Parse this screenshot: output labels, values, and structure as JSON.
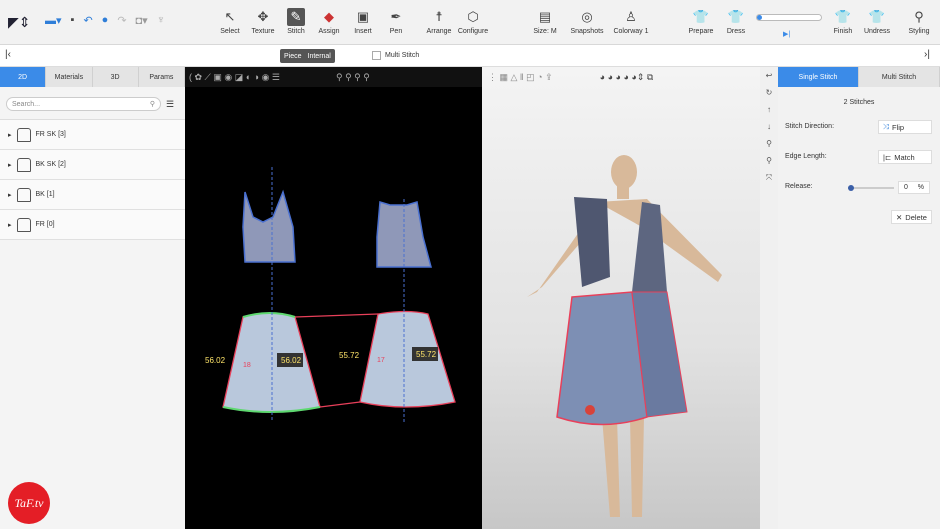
{
  "toolbar": {
    "tools": [
      {
        "label": "Select",
        "icon": "↖"
      },
      {
        "label": "Texture",
        "icon": "✥"
      },
      {
        "label": "Stitch",
        "icon": "✎"
      },
      {
        "label": "Assign",
        "icon": "◆"
      },
      {
        "label": "Insert",
        "icon": "▣"
      },
      {
        "label": "Pen",
        "icon": "✒"
      },
      {
        "label": "Arrange",
        "icon": "☨"
      },
      {
        "label": "Configure",
        "icon": "⬡"
      },
      {
        "label": "Size: M",
        "icon": "▤"
      },
      {
        "label": "Snapshots",
        "icon": "◎"
      },
      {
        "label": "Colorway 1",
        "icon": "♙"
      },
      {
        "label": "Prepare",
        "icon": "👕"
      },
      {
        "label": "Dress",
        "icon": "👕"
      },
      {
        "label": "Finish",
        "icon": "👕"
      },
      {
        "label": "Undress",
        "icon": "👕"
      },
      {
        "label": "Styling",
        "icon": "⚲"
      }
    ],
    "play": "▶|"
  },
  "bar2": {
    "piece": "Piece",
    "internal": "Internal",
    "multi": "Multi Stitch"
  },
  "left": {
    "tabs": [
      "2D",
      "Materials",
      "3D",
      "Params"
    ],
    "search_placeholder": "Search...",
    "items": [
      "FR SK [3]",
      "BK SK [2]",
      "BK [1]",
      "FR [0]"
    ]
  },
  "pattern": {
    "labels": [
      "56.02",
      "56.02",
      "55.72",
      "55.72"
    ],
    "numbers": [
      "18",
      "17"
    ]
  },
  "right": {
    "tabs": [
      "Single Stitch",
      "Multi Stitch"
    ],
    "count": "2 Stitches",
    "direction_label": "Stitch Direction:",
    "flip": "Flip",
    "edge_label": "Edge Length:",
    "match": "Match",
    "release_label": "Release:",
    "release_value": "0",
    "unit": "%",
    "delete": "Delete"
  },
  "logo": "TaF.tv",
  "colors": {
    "accent": "#3b8be8",
    "stitch": "#e8405a"
  }
}
